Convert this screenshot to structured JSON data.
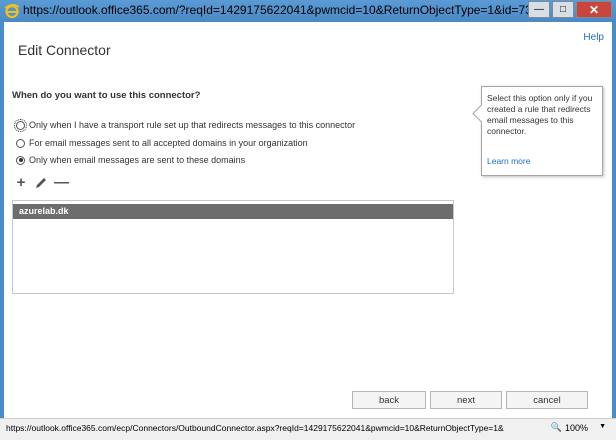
{
  "browser": {
    "url": "https://outlook.office365.com/?reqId=1429175622041&pwmcid=10&ReturnObjectType=1&id=7315d...",
    "status_url": "https://outlook.office365.com/ecp/Connectors/OutboundConnector.aspx?reqId=1429175622041&pwmcid=10&ReturnObjectType=1&",
    "zoom": "100%"
  },
  "dialog": {
    "help_link": "Help",
    "title": "Edit Connector",
    "question": "When do you want to use this connector?",
    "options": [
      {
        "label": "Only when I have a transport rule set up that redirects messages to this connector",
        "selected": false
      },
      {
        "label": "For email messages sent to all accepted domains in your organization",
        "selected": false
      },
      {
        "label": "Only when email messages are sent to these domains",
        "selected": true
      }
    ],
    "domains": [
      "azurelab.dk"
    ],
    "callout": {
      "text": "Select this option only if you created a rule that redirects email messages to this connector.",
      "link": "Learn more"
    },
    "buttons": {
      "back": "back",
      "next": "next",
      "cancel": "cancel"
    }
  }
}
